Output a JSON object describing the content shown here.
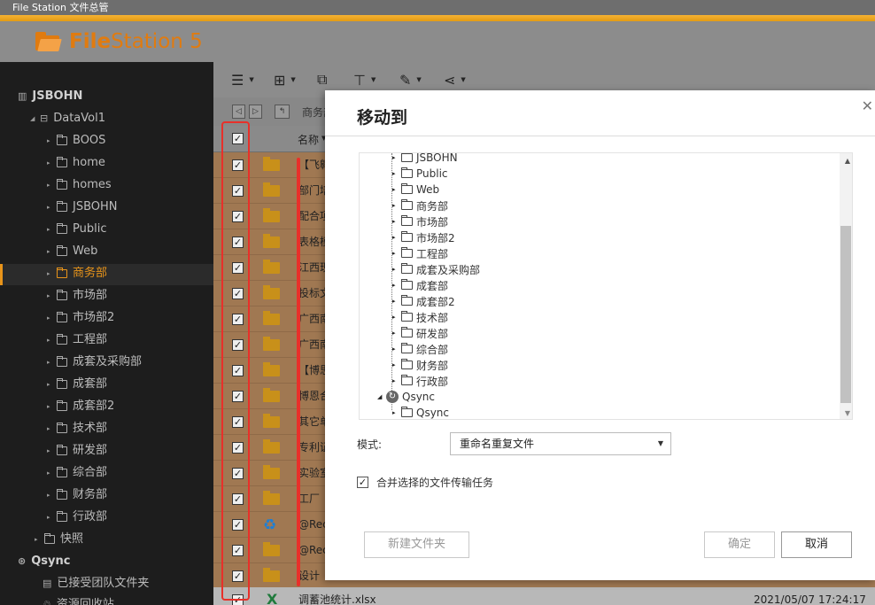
{
  "window": {
    "title": "File Station 文件总管"
  },
  "app": {
    "logo_bold": "File",
    "logo_rest": "Station 5"
  },
  "sidebar": {
    "host": "JSBOHN",
    "volume": "DataVol1",
    "folders": [
      "BOOS",
      "home",
      "homes",
      "JSBOHN",
      "Public",
      "Web",
      "商务部",
      "市场部",
      "市场部2",
      "工程部",
      "成套及采购部",
      "成套部",
      "成套部2",
      "技术部",
      "研发部",
      "综合部",
      "财务部",
      "行政部"
    ],
    "snapshot": "快照",
    "qsync": "Qsync",
    "qsync_items": [
      "已接受团队文件夹",
      "资源回收站"
    ]
  },
  "toolbar": {
    "nav_partial": "商务部"
  },
  "list": {
    "header_name": "名称",
    "rows": [
      "【飞翱",
      "部门培",
      "配合项",
      "表格模",
      "江西现",
      "投标文",
      "广西南",
      "广西南",
      "【博思",
      "博恩合",
      "其它单",
      "专利证",
      "实验室",
      "工厂",
      "@Recy",
      "@Rec",
      "设计"
    ],
    "last_row": {
      "name": "调蓄池统计.xlsx",
      "date": "2021/05/07 17:24:17"
    }
  },
  "dialog": {
    "title": "移动到",
    "tree": [
      "JSBOHN",
      "Public",
      "Web",
      "商务部",
      "市场部",
      "市场部2",
      "工程部",
      "成套及采购部",
      "成套部",
      "成套部2",
      "技术部",
      "研发部",
      "综合部",
      "财务部",
      "行政部"
    ],
    "qsync_node": "Qsync",
    "qsync_child": "Qsync",
    "mode_label": "模式:",
    "mode_value": "重命名重复文件",
    "merge_label": "合并选择的文件传输任务",
    "new_folder": "新建文件夹",
    "ok": "确定",
    "cancel": "取消"
  }
}
